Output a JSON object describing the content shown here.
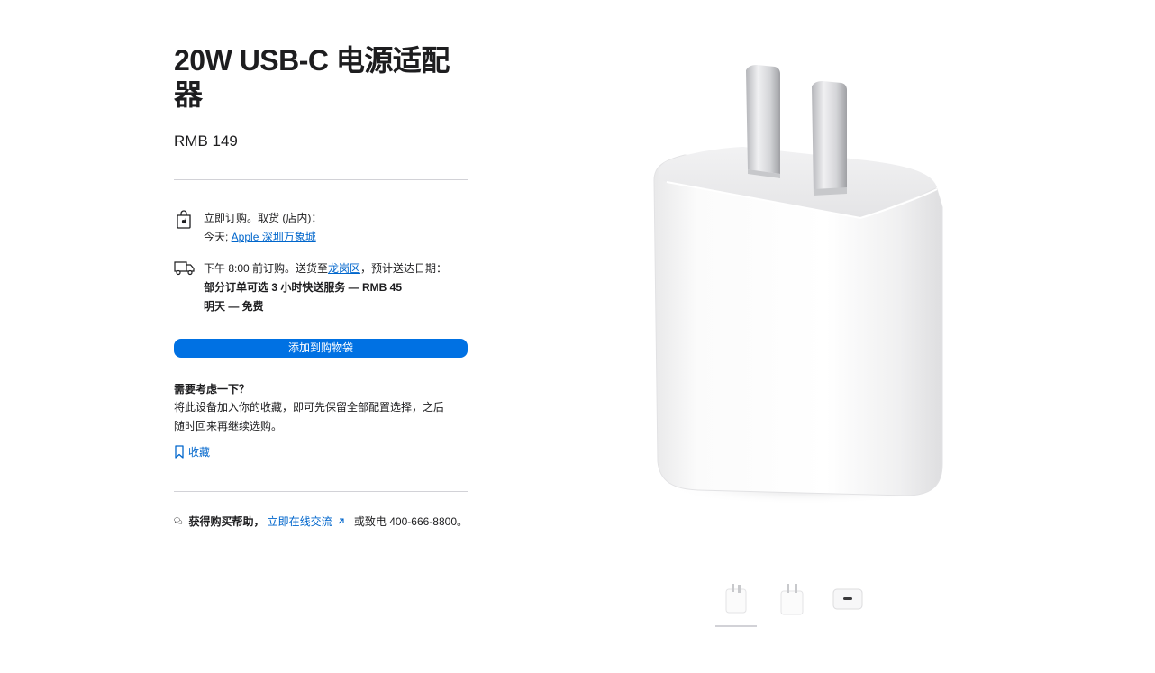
{
  "product": {
    "title": "20W USB-C 电源适配器",
    "price": "RMB 149"
  },
  "pickup": {
    "line1": "立即订购。取货 (店内)：",
    "today_prefix": "今天; ",
    "store_link": "Apple 深圳万象城"
  },
  "delivery": {
    "prefix": "下午 8:00 前订购。送货至",
    "area_link": "龙岗区",
    "suffix": "，预计送达日期：",
    "option1": "部分订单可选 3 小时快送服务 — RMB 45",
    "option2": "明天 — 免费"
  },
  "add_to_bag_label": "添加到购物袋",
  "consider": {
    "heading": "需要考虑一下？",
    "body": "将此设备加入你的收藏，即可先保留全部配置选择，之后随时回来再继续选购。",
    "save_label": "收藏"
  },
  "help": {
    "label": "获得购买帮助，",
    "chat_link": "立即在线交流",
    "suffix": "或致电 400-666-8800。"
  },
  "colors": {
    "accent": "#0071e3",
    "link": "#0066cc",
    "text": "#1d1d1f",
    "divider": "#d2d2d7"
  },
  "icons": {
    "pickup": "apple-bag-icon",
    "delivery": "truck-icon",
    "save": "bookmark-icon",
    "help": "chat-bubbles-icon",
    "external": "arrow-up-right-icon"
  },
  "gallery": {
    "selected_index": 0,
    "thumbnails": [
      "adapter-front",
      "adapter-back",
      "adapter-usb-c-port"
    ]
  }
}
